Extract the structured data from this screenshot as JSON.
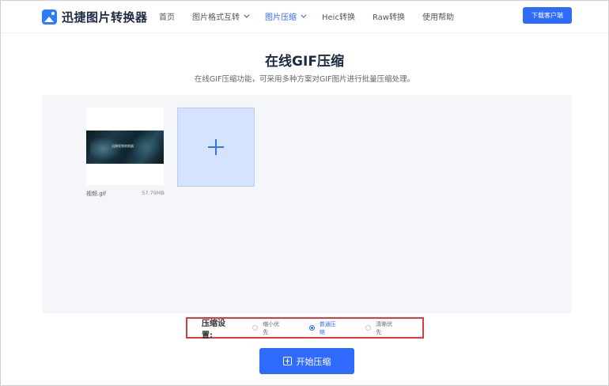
{
  "header": {
    "logo_text": "迅捷图片转换器",
    "nav": [
      {
        "label": "首页",
        "dropdown": false,
        "active": false
      },
      {
        "label": "图片格式互转",
        "dropdown": true,
        "active": false
      },
      {
        "label": "图片压缩",
        "dropdown": true,
        "active": true
      },
      {
        "label": "Heic转换",
        "dropdown": false,
        "active": false
      },
      {
        "label": "Raw转换",
        "dropdown": false,
        "active": false
      },
      {
        "label": "使用帮助",
        "dropdown": false,
        "active": false
      }
    ],
    "download_label": "下载客户端"
  },
  "main": {
    "title": "在线GIF压缩",
    "subtitle": "在线GIF压缩功能，可采用多种方案对GIF图片进行批量压缩处理。"
  },
  "upload": {
    "files": [
      {
        "name": "视频.gif",
        "size": "57.79MB",
        "thumb_caption": "迅捷视频转换器"
      }
    ]
  },
  "settings": {
    "label": "压缩设置:",
    "options": [
      {
        "label": "缩小优先",
        "checked": false
      },
      {
        "label": "普通压缩",
        "checked": true
      },
      {
        "label": "清晰优先",
        "checked": false
      }
    ]
  },
  "actions": {
    "start_label": "开始压缩"
  },
  "colors": {
    "accent": "#2f6bff",
    "highlight_border": "#e03b3b",
    "panel_bg": "#f5f6f9",
    "add_tile_bg": "#d5e3ff"
  }
}
